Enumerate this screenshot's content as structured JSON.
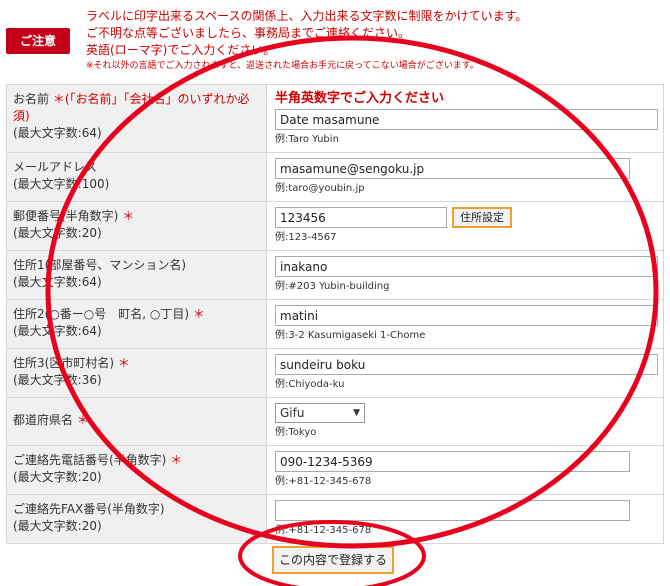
{
  "notice": {
    "badge": "ご注意",
    "lines": [
      "ラベルに印字出来るスペースの関係上、入力出来る文字数に制限をかけています。",
      "ご不明な点等ございましたら、事務局までご連絡ください。",
      "英語(ローマ字)でご入力ください。"
    ],
    "small": "※それ以外の言語でご入力されますと、返送された場合お手元に戻ってこない場合がございます。"
  },
  "form": {
    "instruction": "半角英数字でご入力ください",
    "rows": [
      {
        "label": "お名前",
        "required_note": "＊(「お名前」「会社名」のいずれか必須)",
        "maxlen": "(最大文字数:64)",
        "value": "Date masamune",
        "example": "例:Taro Yubin"
      },
      {
        "label": "メールアドレス",
        "required_note": "",
        "maxlen": "(最大文字数:100)",
        "value": "masamune@sengoku.jp",
        "example": "例:taro@youbin.jp"
      },
      {
        "label": "郵便番号(半角数字)",
        "required_note": "＊",
        "maxlen": "(最大文字数:20)",
        "value": "123456",
        "example": "例:123-4567",
        "button": "住所設定"
      },
      {
        "label": "住所1(部屋番号、マンション名)",
        "required_note": "",
        "maxlen": "(最大文字数:64)",
        "value": "inakano",
        "example": "例:#203 Yubin-building"
      },
      {
        "label": "住所2(○番ー○号　町名, ○丁目)",
        "required_note": "＊",
        "maxlen": "(最大文字数:64)",
        "value": "matini",
        "example": "例:3-2 Kasumigaseki 1-Chome"
      },
      {
        "label": "住所3(区市町村名)",
        "required_note": "＊",
        "maxlen": "(最大文字数:36)",
        "value": "sundeiru boku",
        "example": "例:Chiyoda-ku"
      },
      {
        "label": "都道府県名",
        "required_note": "＊",
        "maxlen": "",
        "value": "Gifu",
        "example": "例:Tokyo"
      },
      {
        "label": "ご連絡先電話番号(半角数字)",
        "required_note": "＊",
        "maxlen": "(最大文字数:20)",
        "value": "090-1234-5369",
        "example": "例:+81-12-345-678"
      },
      {
        "label": "ご連絡先FAX番号(半角数字)",
        "required_note": "",
        "maxlen": "(最大文字数:20)",
        "value": "",
        "example": "例:+81-12-345-678"
      }
    ]
  },
  "submit": {
    "label": "この内容で登録する"
  },
  "annotations": {
    "color": "#e8001c"
  }
}
